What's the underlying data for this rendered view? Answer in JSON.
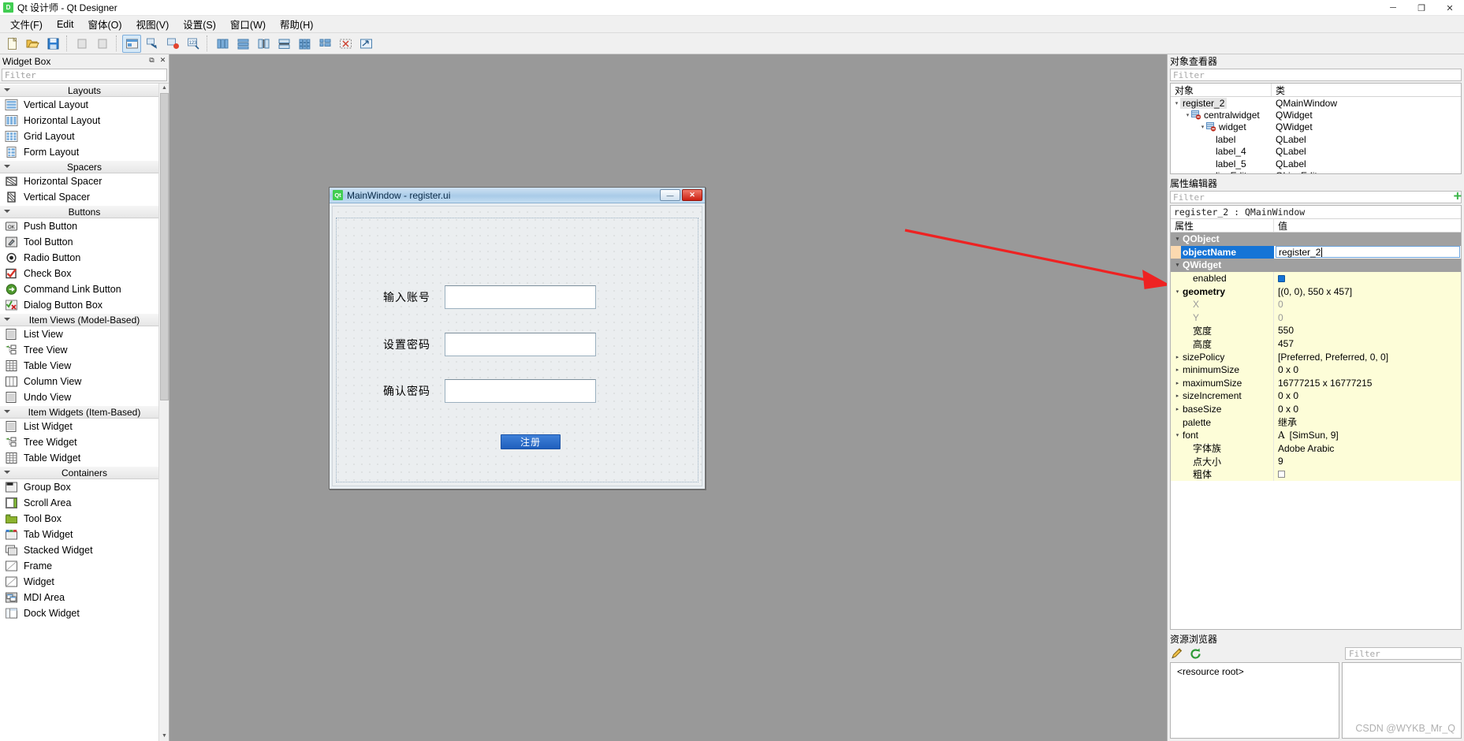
{
  "app": {
    "title": "Qt 设计师 - Qt Designer",
    "logo_text": "D",
    "window_buttons": {
      "minimize": "─",
      "maximize": "❐",
      "close": "✕"
    }
  },
  "menubar": {
    "items": [
      {
        "label": "文件(F)"
      },
      {
        "label": "Edit"
      },
      {
        "label": "窗体(O)"
      },
      {
        "label": "视图(V)"
      },
      {
        "label": "设置(S)"
      },
      {
        "label": "窗口(W)"
      },
      {
        "label": "帮助(H)"
      }
    ]
  },
  "toolbar": {
    "groups": [
      [
        "new-form",
        "open-form",
        "save-form"
      ],
      [
        "undo",
        "redo"
      ],
      [
        "edit-widgets",
        "edit-signals-slots",
        "edit-buddies",
        "edit-tab-order"
      ],
      [
        "layout-horizontally",
        "layout-vertically",
        "layout-splitter-h",
        "layout-splitter-v",
        "layout-grid",
        "layout-form",
        "break-layout",
        "adjust-size"
      ]
    ]
  },
  "widget_box": {
    "title": "Widget Box",
    "filter_placeholder": "Filter",
    "categories": [
      {
        "name": "Layouts",
        "items": [
          {
            "label": "Vertical Layout",
            "icon": "vertical-layout-icon"
          },
          {
            "label": "Horizontal Layout",
            "icon": "horizontal-layout-icon"
          },
          {
            "label": "Grid Layout",
            "icon": "grid-layout-icon"
          },
          {
            "label": "Form Layout",
            "icon": "form-layout-icon"
          }
        ]
      },
      {
        "name": "Spacers",
        "items": [
          {
            "label": "Horizontal Spacer",
            "icon": "horizontal-spacer-icon"
          },
          {
            "label": "Vertical Spacer",
            "icon": "vertical-spacer-icon"
          }
        ]
      },
      {
        "name": "Buttons",
        "items": [
          {
            "label": "Push Button",
            "icon": "push-button-icon"
          },
          {
            "label": "Tool Button",
            "icon": "tool-button-icon"
          },
          {
            "label": "Radio Button",
            "icon": "radio-button-icon"
          },
          {
            "label": "Check Box",
            "icon": "check-box-icon"
          },
          {
            "label": "Command Link Button",
            "icon": "command-link-button-icon"
          },
          {
            "label": "Dialog Button Box",
            "icon": "dialog-button-box-icon"
          }
        ]
      },
      {
        "name": "Item Views (Model-Based)",
        "items": [
          {
            "label": "List View",
            "icon": "list-view-icon"
          },
          {
            "label": "Tree View",
            "icon": "tree-view-icon"
          },
          {
            "label": "Table View",
            "icon": "table-view-icon"
          },
          {
            "label": "Column View",
            "icon": "column-view-icon"
          },
          {
            "label": "Undo View",
            "icon": "undo-view-icon"
          }
        ]
      },
      {
        "name": "Item Widgets (Item-Based)",
        "items": [
          {
            "label": "List Widget",
            "icon": "list-widget-icon"
          },
          {
            "label": "Tree Widget",
            "icon": "tree-widget-icon"
          },
          {
            "label": "Table Widget",
            "icon": "table-widget-icon"
          }
        ]
      },
      {
        "name": "Containers",
        "items": [
          {
            "label": "Group Box",
            "icon": "group-box-icon"
          },
          {
            "label": "Scroll Area",
            "icon": "scroll-area-icon"
          },
          {
            "label": "Tool Box",
            "icon": "tool-box-icon"
          },
          {
            "label": "Tab Widget",
            "icon": "tab-widget-icon"
          },
          {
            "label": "Stacked Widget",
            "icon": "stacked-widget-icon"
          },
          {
            "label": "Frame",
            "icon": "frame-icon"
          },
          {
            "label": "Widget",
            "icon": "widget-icon"
          },
          {
            "label": "MDI Area",
            "icon": "mdi-area-icon"
          },
          {
            "label": "Dock Widget",
            "icon": "dock-widget-icon"
          }
        ]
      }
    ]
  },
  "form": {
    "title": "MainWindow - register.ui",
    "logo_text": "Qt",
    "window_buttons": {
      "minimize": "—",
      "close": "✕"
    },
    "rows": [
      {
        "label": "输入账号",
        "value": ""
      },
      {
        "label": "设置密码",
        "value": ""
      },
      {
        "label": "确认密码",
        "value": ""
      }
    ],
    "submit_label": "注册"
  },
  "object_inspector": {
    "title": "对象查看器",
    "filter_placeholder": "Filter",
    "columns": [
      "对象",
      "类"
    ],
    "rows": [
      {
        "name": "register_2",
        "class": "QMainWindow",
        "indent": 0,
        "expander": "open",
        "icon": null,
        "selected": false
      },
      {
        "name": "centralwidget",
        "class": "QWidget",
        "indent": 1,
        "expander": "open",
        "icon": "layout-broken-icon",
        "selected": false
      },
      {
        "name": "widget",
        "class": "QWidget",
        "indent": 2,
        "expander": "open",
        "icon": "layout-broken-icon",
        "selected": false
      },
      {
        "name": "label",
        "class": "QLabel",
        "indent": 3,
        "expander": null,
        "icon": null,
        "selected": false
      },
      {
        "name": "label_4",
        "class": "QLabel",
        "indent": 3,
        "expander": null,
        "icon": null,
        "selected": false
      },
      {
        "name": "label_5",
        "class": "QLabel",
        "indent": 3,
        "expander": null,
        "icon": null,
        "selected": false
      },
      {
        "name": "lineEdit",
        "class": "QLineEdit",
        "indent": 3,
        "expander": null,
        "icon": null,
        "selected": false
      }
    ]
  },
  "property_editor": {
    "title": "属性编辑器",
    "filter_placeholder": "Filter",
    "selected_object": "register_2 : QMainWindow",
    "columns": [
      "属性",
      "值"
    ],
    "rows": [
      {
        "kind": "group",
        "name": "QObject",
        "value": "",
        "expander": "open"
      },
      {
        "kind": "selected",
        "name": "objectName",
        "value": "register_2",
        "editing": true
      },
      {
        "kind": "group",
        "name": "QWidget",
        "value": "",
        "expander": "open"
      },
      {
        "kind": "normal",
        "name": "enabled",
        "value": "",
        "control": "checkbox-on",
        "indent": 1
      },
      {
        "kind": "normal",
        "name": "geometry",
        "value": "[(0, 0), 550 x 457]",
        "expander": "open",
        "bold": true
      },
      {
        "kind": "normal",
        "name": "X",
        "value": "0",
        "indent": 2,
        "dim": true
      },
      {
        "kind": "normal",
        "name": "Y",
        "value": "0",
        "indent": 2,
        "dim": true
      },
      {
        "kind": "normal",
        "name": "宽度",
        "value": "550",
        "indent": 2
      },
      {
        "kind": "normal",
        "name": "高度",
        "value": "457",
        "indent": 2
      },
      {
        "kind": "normal",
        "name": "sizePolicy",
        "value": "[Preferred, Preferred, 0, 0]",
        "expander": "closed"
      },
      {
        "kind": "normal",
        "name": "minimumSize",
        "value": "0 x 0",
        "expander": "closed"
      },
      {
        "kind": "normal",
        "name": "maximumSize",
        "value": "16777215 x 16777215",
        "expander": "closed"
      },
      {
        "kind": "normal",
        "name": "sizeIncrement",
        "value": "0 x 0",
        "expander": "closed"
      },
      {
        "kind": "normal",
        "name": "baseSize",
        "value": "0 x 0",
        "expander": "closed"
      },
      {
        "kind": "normal",
        "name": "palette",
        "value": "继承",
        "indent": 1
      },
      {
        "kind": "normal",
        "name": "font",
        "value": "[SimSun, 9]",
        "expander": "open",
        "control": "font-glyph",
        "indent": 1
      },
      {
        "kind": "normal",
        "name": "字体族",
        "value": "Adobe Arabic",
        "indent": 2
      },
      {
        "kind": "normal",
        "name": "点大小",
        "value": "9",
        "indent": 2
      },
      {
        "kind": "normal",
        "name": "粗体",
        "value": "",
        "control": "checkbox-off",
        "indent": 2
      }
    ]
  },
  "resource_browser": {
    "title": "资源浏览器",
    "filter_placeholder": "Filter",
    "root_label": "<resource root>",
    "toolbar": [
      "edit-resources-icon",
      "reload-icon"
    ]
  },
  "watermark": "CSDN @WYKB_Mr_Q",
  "colors": {
    "accent_blue": "#1574d6",
    "qt_green": "#41cd52",
    "canvas_gray": "#999999",
    "property_yellow": "#fdfdd8",
    "group_gray": "#a0a0a0",
    "annotation_red": "#ee2222",
    "form_button_blue": "#2a66c4"
  }
}
